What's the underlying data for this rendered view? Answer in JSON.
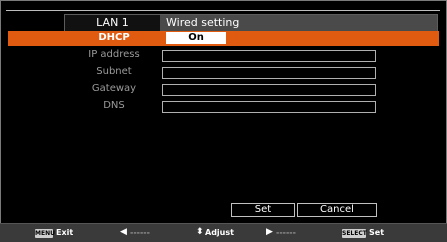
{
  "header": {
    "tab_label": "LAN 1",
    "title": "Wired setting"
  },
  "dhcp": {
    "label": "DHCP",
    "value": "On"
  },
  "fields": [
    {
      "label": "IP address",
      "value": ""
    },
    {
      "label": "Subnet",
      "value": ""
    },
    {
      "label": "Gateway",
      "value": ""
    },
    {
      "label": "DNS",
      "value": ""
    }
  ],
  "buttons": {
    "set": "Set",
    "cancel": "Cancel"
  },
  "footer": {
    "menu_key": "MENU",
    "exit_label": "Exit",
    "left_arrow": "◀",
    "left_dashes": "------",
    "adjust_arrow": "⬍",
    "adjust_label": "Adjust",
    "right_arrow": "▶",
    "right_dashes": "------",
    "select_key": "SELECT",
    "set_label": "Set"
  },
  "colors": {
    "highlight": "#e05a10",
    "footer_bg": "#3a3a3a"
  }
}
